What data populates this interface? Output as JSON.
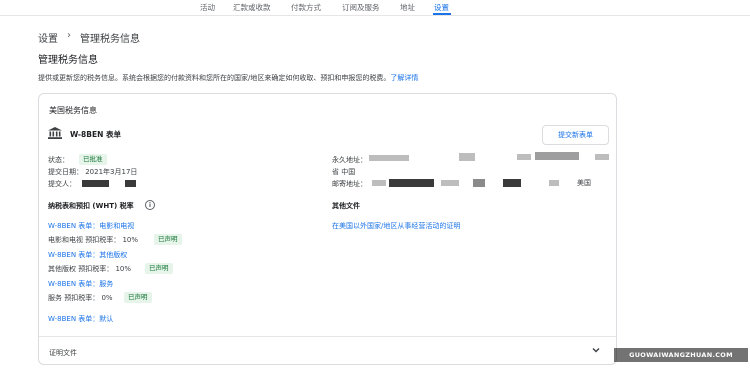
{
  "nav": {
    "tabs": [
      {
        "label": "活动"
      },
      {
        "label": "汇款或收款"
      },
      {
        "label": "付款方式"
      },
      {
        "label": "订阅及服务"
      },
      {
        "label": "地址"
      },
      {
        "label": "设置",
        "active": true
      }
    ]
  },
  "breadcrumb": {
    "parent": "设置",
    "current": "管理税务信息"
  },
  "page": {
    "title": "管理税务信息",
    "description": "提供或更新您的税务信息。系统会根据您的付款资料和您所在的国家/地区来确定如何收取、预扣和申报您的税费。",
    "learn_more": "了解详情"
  },
  "card": {
    "title": "美国税务信息",
    "form_title": "W-8BEN 表单",
    "submit_button": "提交新表单",
    "status_label": "状态：",
    "status_value": "已批准",
    "submitted_date": "提交日期：  2021年3月17日",
    "submitter_label": "提交人：",
    "perm_address_label": "永久地址：",
    "province_label": "省 中国",
    "mailing_address_label": "邮寄地址：",
    "mailing_country": "美国",
    "withholding_title": "纳税表和预扣 (WHT) 税率",
    "withholding_items": [
      {
        "link": "W-8BEN 表单：电影和电视",
        "rate": "电影和电视 预扣税率：  10%",
        "badge": "已声明"
      },
      {
        "link": "W-8BEN 表单：其他版权",
        "rate": "其他版权 预扣税率：  10%",
        "badge": "已声明"
      },
      {
        "link": "W-8BEN 表单：服务",
        "rate": "服务 预扣税率：  0%",
        "badge": "已声明"
      },
      {
        "link": "W-8BEN 表单：默认"
      }
    ],
    "other_docs_title": "其他文件",
    "other_docs_link": "在美国以外国家/地区从事经营活动的证明",
    "cert_docs": "证明文件"
  },
  "watermark": "GUOWAIWANGZHUAN.COM",
  "colors": {
    "accent": "#1a73e8",
    "badge_bg": "#e6f4ea",
    "badge_text": "#137333"
  }
}
